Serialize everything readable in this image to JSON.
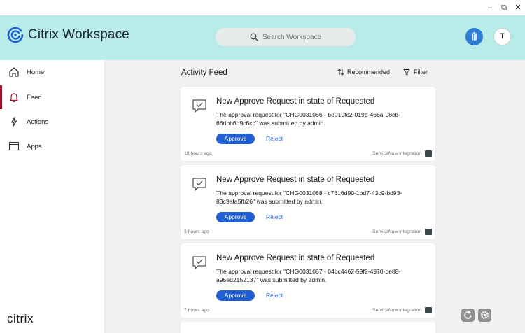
{
  "window": {
    "minimize": "–",
    "restore": "⧉",
    "close": "✕"
  },
  "header": {
    "app_title": "Citrix Workspace",
    "search_placeholder": "Search Workspace",
    "avatar_initial": "T"
  },
  "sidebar": {
    "items": [
      {
        "label": "Home",
        "icon": "home-icon"
      },
      {
        "label": "Feed",
        "icon": "bell-icon",
        "active": true
      },
      {
        "label": "Actions",
        "icon": "bolt-icon"
      },
      {
        "label": "Apps",
        "icon": "window-icon"
      }
    ],
    "footer_brand": "citrix"
  },
  "feed": {
    "title": "Activity Feed",
    "sort_label": "Recommended",
    "filter_label": "Filter",
    "cards": [
      {
        "title": "New Approve Request in state of Requested",
        "body": "The approval request for \"CHG0031066 - be019fc2-019d-466a-98cb-66dbb6d9c6cc\" was submitted by admin.",
        "approve": "Approve",
        "reject": "Reject",
        "time": "19 hours ago",
        "source": "ServiceNow integration"
      },
      {
        "title": "New Approve Request in state of Requested",
        "body": "The approval request for \"CHG0031068 - c7616d90-1bd7-43c9-bd93-83c9afa5fb26\" was submitted by admin.",
        "approve": "Approve",
        "reject": "Reject",
        "time": "3 hours ago",
        "source": "ServiceNow integration"
      },
      {
        "title": "New Approve Request in state of Requested",
        "body": "The approval request for \"CHG0031067 - 04bc4462-59f2-4970-be88-a95ed2152137\" was submitted by admin.",
        "approve": "Approve",
        "reject": "Reject",
        "time": "7 hours ago",
        "source": "ServiceNow integration"
      }
    ]
  },
  "colors": {
    "header_bg": "#b9ebe8",
    "accent_blue": "#1f5fd1",
    "active_nav": "#a2172f",
    "main_bg": "#f1f1f1"
  }
}
